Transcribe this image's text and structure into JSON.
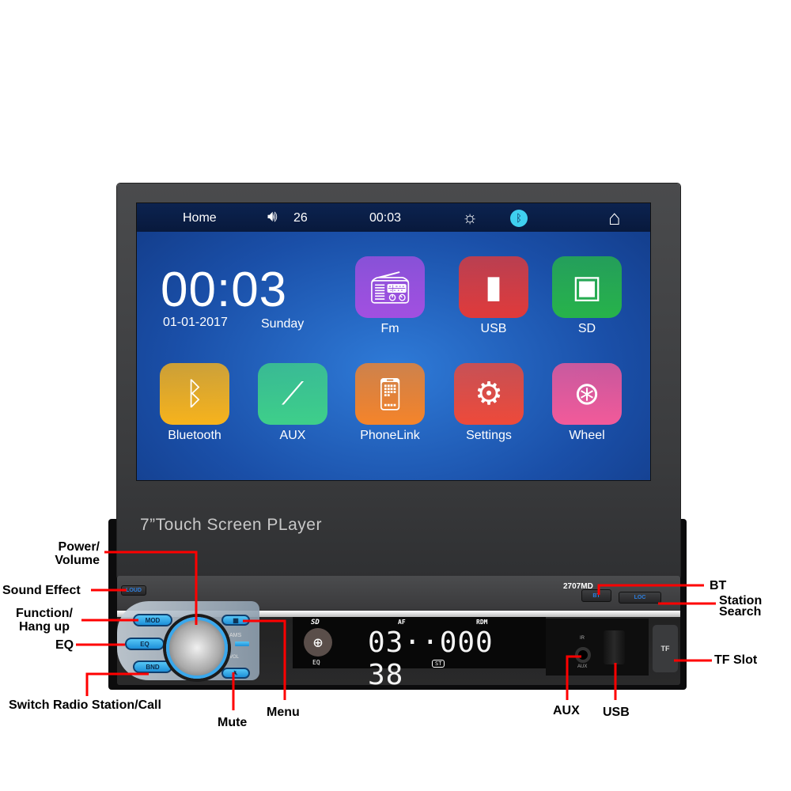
{
  "screen": {
    "topbar": {
      "home_label": "Home",
      "volume_icon": "speaker-icon",
      "volume": "26",
      "time": "00:03",
      "brightness_icon": "sun-icon",
      "bluetooth_icon": "bluetooth-icon",
      "home_icon": "house-icon"
    },
    "clock": "00:03",
    "date": "01-01-2017",
    "day": "Sunday",
    "apps": [
      {
        "label": "Fm",
        "icon": "radio-icon",
        "color": "#a24fe0"
      },
      {
        "label": "USB",
        "icon": "usb-drive-icon",
        "color": "#e03a3a"
      },
      {
        "label": "SD",
        "icon": "sd-card-icon",
        "color": "#27b34a"
      },
      {
        "label": "Bluetooth",
        "icon": "bluetooth-icon",
        "color": "#f7b31c"
      },
      {
        "label": "AUX",
        "icon": "aux-cable-icon",
        "color": "#3ecf8a"
      },
      {
        "label": "PhoneLink",
        "icon": "phone-link-icon",
        "color": "#f5842a"
      },
      {
        "label": "Settings",
        "icon": "gear-icon",
        "color": "#ee4a3a"
      },
      {
        "label": "Wheel",
        "icon": "steering-wheel-icon",
        "color": "#f25a9a"
      }
    ]
  },
  "caption": "7”Touch Screen PLayer",
  "faceplate": {
    "model": "2707MD",
    "buttons": {
      "loud": "LOUD",
      "mod": "MOD",
      "eq": "EQ",
      "bnd": "BND",
      "ams": "AMS",
      "vol": "VOL",
      "bt": "BT",
      "loc": "LOC",
      "tf": "TF",
      "ir": "IR",
      "aux": "AUX"
    },
    "lcd": {
      "digits": "03··000 38",
      "sd": "SD",
      "eq": "EQ",
      "af": "AF",
      "rdm": "RDM",
      "st": "ST"
    }
  },
  "annotations": {
    "power_volume": [
      "Power/",
      "Volume"
    ],
    "sound_effect": "Sound Effect",
    "function_hangup": [
      "Function/",
      "Hang up"
    ],
    "eq": "EQ",
    "switch_radio": "Switch Radio Station/Call",
    "mute": "Mute",
    "menu": "Menu",
    "bt": "BT",
    "station_search": [
      "Station",
      "Search"
    ],
    "tf_slot": "TF Slot",
    "aux": "AUX",
    "usb": "USB"
  },
  "colors": {
    "annotation_line": "#ff0000",
    "accent_blue": "#2fa4ea"
  }
}
